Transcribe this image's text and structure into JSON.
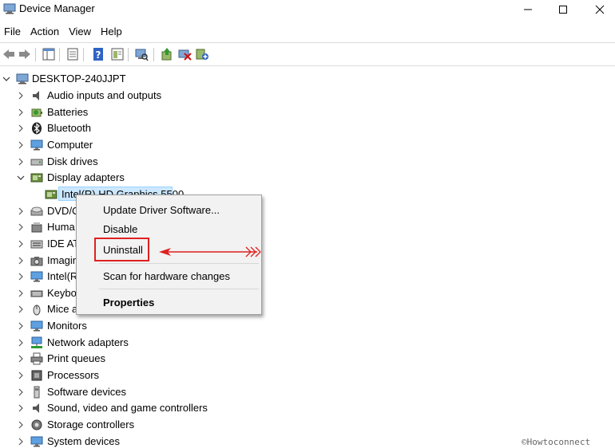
{
  "window": {
    "title": "Device Manager",
    "controls": {
      "minimize": "minimize-icon",
      "maximize": "maximize-icon",
      "close": "close-icon"
    }
  },
  "menubar": [
    "File",
    "Action",
    "View",
    "Help"
  ],
  "toolbar": {
    "buttons": [
      "back-arrow-icon",
      "forward-arrow-icon",
      "console-tree-icon",
      "properties-icon",
      "help-icon",
      "view-icon",
      "scan-hardware-icon",
      "update-driver-icon",
      "uninstall-device-icon",
      "add-legacy-hardware-icon"
    ]
  },
  "tree": {
    "root": "DESKTOP-240JJPT",
    "categories": [
      {
        "label": "Audio inputs and outputs",
        "icon": "speaker-icon"
      },
      {
        "label": "Batteries",
        "icon": "battery-icon"
      },
      {
        "label": "Bluetooth",
        "icon": "bluetooth-icon"
      },
      {
        "label": "Computer",
        "icon": "monitor-icon"
      },
      {
        "label": "Disk drives",
        "icon": "disk-drive-icon"
      },
      {
        "label": "Display adapters",
        "icon": "display-adapter-icon",
        "expanded": true
      },
      {
        "label": "DVD/C",
        "icon": "dvd-icon"
      },
      {
        "label": "Huma",
        "icon": "hid-icon"
      },
      {
        "label": "IDE AT",
        "icon": "ide-icon"
      },
      {
        "label": "Imagin",
        "icon": "camera-icon"
      },
      {
        "label": "Intel(R",
        "icon": "monitor-icon"
      },
      {
        "label": "Keybo",
        "icon": "keyboard-icon"
      },
      {
        "label": "Mice a",
        "icon": "mouse-icon"
      },
      {
        "label": "Monitors",
        "icon": "monitor-icon"
      },
      {
        "label": "Network adapters",
        "icon": "network-icon"
      },
      {
        "label": "Print queues",
        "icon": "printer-icon"
      },
      {
        "label": "Processors",
        "icon": "processor-icon"
      },
      {
        "label": "Software devices",
        "icon": "software-device-icon"
      },
      {
        "label": "Sound, video and game controllers",
        "icon": "speaker-icon"
      },
      {
        "label": "Storage controllers",
        "icon": "storage-controller-icon"
      },
      {
        "label": "System devices",
        "icon": "monitor-icon"
      }
    ],
    "selected_child": "Intel(R) HD Graphics 5500"
  },
  "context_menu": {
    "items": [
      "Update Driver Software...",
      "Disable",
      "Uninstall",
      "Scan for hardware changes",
      "Properties"
    ],
    "highlighted": "Uninstall"
  },
  "watermark": "©Howtoconnect",
  "colors": {
    "selection": "#cce8ff",
    "highlight_box": "#e02020",
    "menu_bg": "#f2f2f2"
  }
}
